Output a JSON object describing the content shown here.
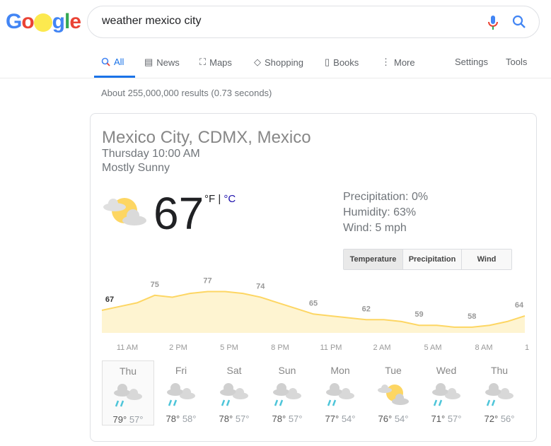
{
  "logo_text": "Google",
  "search": {
    "query": "weather mexico city"
  },
  "tabs": [
    {
      "label": "All",
      "icon": "search-icon"
    },
    {
      "label": "News",
      "icon": "news-icon"
    },
    {
      "label": "Maps",
      "icon": "map-icon"
    },
    {
      "label": "Shopping",
      "icon": "tag-icon"
    },
    {
      "label": "Books",
      "icon": "book-icon"
    },
    {
      "label": "More",
      "icon": "more-vert-icon"
    }
  ],
  "tools": {
    "settings": "Settings",
    "tools": "Tools"
  },
  "result_stats": "About 255,000,000 results (0.73 seconds)",
  "weather": {
    "location": "Mexico City, CDMX, Mexico",
    "time": "Thursday 10:00 AM",
    "condition": "Mostly Sunny",
    "temp": "67",
    "unit_f": "°F",
    "unit_sep": " | ",
    "unit_c": "°C",
    "precipitation": "Precipitation: 0%",
    "humidity": "Humidity: 63%",
    "wind": "Wind: 5 mph",
    "buttons": [
      "Temperature",
      "Precipitation",
      "Wind"
    ],
    "chart_data": {
      "type": "area",
      "hourly_values": [
        67,
        69,
        71,
        75,
        74,
        76,
        77,
        77,
        76,
        74,
        71,
        68,
        65,
        64,
        63,
        62,
        62,
        61,
        59,
        59,
        58,
        58,
        59,
        61,
        64
      ],
      "labels": [
        "67",
        "75",
        "77",
        "74",
        "65",
        "62",
        "59",
        "58",
        "64"
      ],
      "time_labels": [
        "11 AM",
        "2 PM",
        "5 PM",
        "8 PM",
        "11 PM",
        "2 AM",
        "5 AM",
        "8 AM",
        "1"
      ],
      "line_color": "#fdd663",
      "fill_color": "#fef4d1"
    },
    "days": [
      {
        "day": "Thu",
        "hi": "79°",
        "lo": "57°",
        "icon": "rain-cloud"
      },
      {
        "day": "Fri",
        "hi": "78°",
        "lo": "58°",
        "icon": "rain-cloud"
      },
      {
        "day": "Sat",
        "hi": "78°",
        "lo": "57°",
        "icon": "rain-cloud"
      },
      {
        "day": "Sun",
        "hi": "78°",
        "lo": "57°",
        "icon": "rain-cloud"
      },
      {
        "day": "Mon",
        "hi": "77°",
        "lo": "54°",
        "icon": "rain-cloud"
      },
      {
        "day": "Tue",
        "hi": "76°",
        "lo": "54°",
        "icon": "partly-sunny"
      },
      {
        "day": "Wed",
        "hi": "71°",
        "lo": "57°",
        "icon": "rain-cloud"
      },
      {
        "day": "Thu",
        "hi": "72°",
        "lo": "56°",
        "icon": "rain-cloud"
      }
    ]
  }
}
